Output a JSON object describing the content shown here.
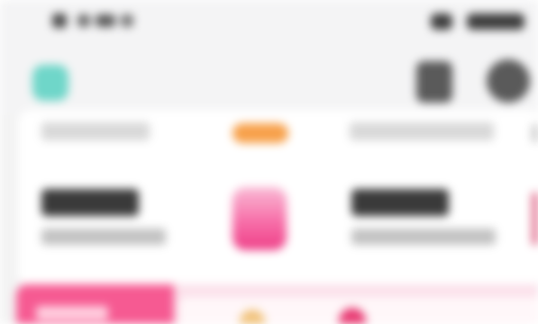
{
  "status_bar": {
    "time": "",
    "left_text": "",
    "right_text": ""
  },
  "header": {
    "logo_icon": "mint-app-icon",
    "actions": [
      {
        "icon": "list-icon"
      },
      {
        "icon": "avatar-icon"
      }
    ]
  },
  "card": {
    "captions": [
      "",
      ""
    ],
    "badge_label": "",
    "features": [
      {
        "title": "",
        "subtitle": "",
        "icon": ""
      },
      {
        "title": "",
        "subtitle": "",
        "icon": "pink-document-icon"
      },
      {
        "title": "",
        "subtitle": "",
        "icon": ""
      }
    ]
  },
  "banner": {
    "tab_label": ""
  },
  "colors": {
    "accent_pink": "#f65a92",
    "mint": "#6fd6c9",
    "badge_orange": "#f7a14b"
  }
}
